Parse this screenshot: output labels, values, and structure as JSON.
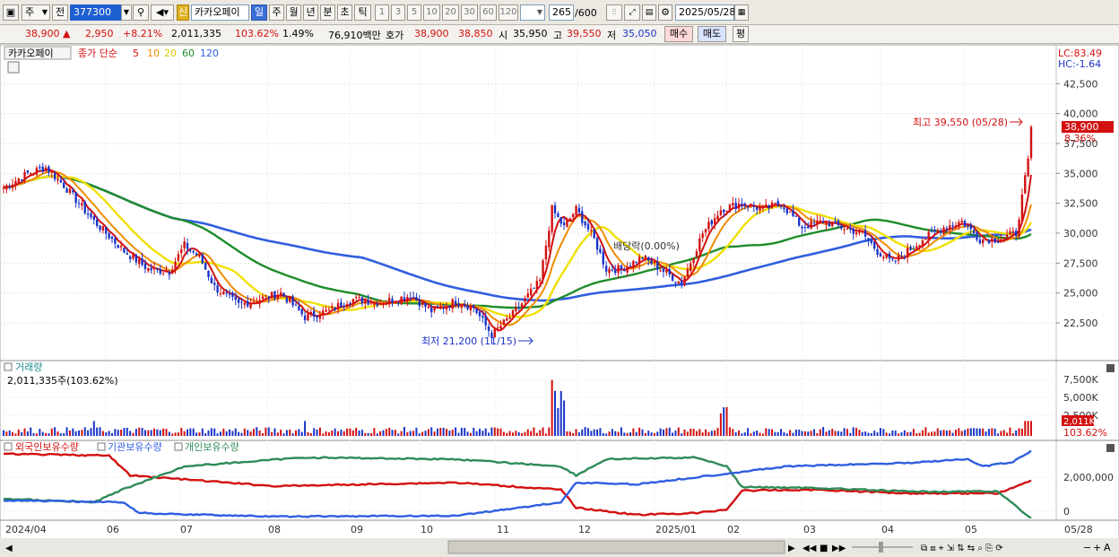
{
  "toolbar": {
    "market": "주",
    "prev": "전",
    "code": "377300",
    "stock_badge": "신",
    "stock_name": "카카오페이",
    "periods": [
      "일",
      "주",
      "월",
      "년",
      "분",
      "초",
      "틱"
    ],
    "active_period": "일",
    "pages": [
      "1",
      "3",
      "5",
      "10",
      "20",
      "30",
      "60",
      "120"
    ],
    "count": "265",
    "count_total": "/600",
    "date": "2025/05/28"
  },
  "quote": {
    "price": "38,900",
    "change": "2,950",
    "rate": "+8.21%",
    "volume": "2,011,335",
    "vol_ratio": "103.62%",
    "turnover": "1.49%",
    "amount": "76,910백만",
    "hoga_label": "호가",
    "hoga_ask": "38,900",
    "hoga_bid": "38,850",
    "open_label": "시",
    "open": "35,950",
    "high_label": "고",
    "high": "39,550",
    "low_label": "저",
    "low": "35,050",
    "buy": "매수",
    "sell": "매도",
    "avg": "평"
  },
  "main_panel": {
    "title": "카카오페이",
    "ma_label": "종가 단순",
    "ma_periods": [
      "5",
      "10",
      "20",
      "60",
      "120"
    ],
    "lc": "LC:83.49",
    "hc": "HC:-1.64",
    "annot_high": "최고 39,550 (05/28)",
    "annot_low": "최저 21,200 (11/15)",
    "annot_div": "배당락(0.00%)",
    "price_tag": "38,900",
    "price_pct": "8.36%"
  },
  "vol_panel": {
    "title": "거래량",
    "value": "2,011,335주(103.62%)",
    "tag": "2,011K",
    "tag_pct": "103.62%"
  },
  "hold_panel": {
    "legend": [
      "외국인보유수량",
      "기관보유수량",
      "개인보유수량"
    ]
  },
  "time_axis": [
    "2024/04",
    "06",
    "07",
    "08",
    "09",
    "10",
    "11",
    "12",
    "2025/01",
    "02",
    "03",
    "04",
    "05",
    "05/28"
  ],
  "colors": {
    "up": "#d31010",
    "down": "#1a34c8",
    "ma5": "#d31010",
    "ma10": "#f08c00",
    "ma20": "#f0e000",
    "ma60": "#1e8c2a",
    "ma120": "#2f5ee0",
    "foreign": "#d31010",
    "inst": "#2f5ee0",
    "indiv": "#2e8b57"
  },
  "chart_data": {
    "type": "candlestick",
    "price_ticks": [
      22500,
      25000,
      27500,
      30000,
      32500,
      35000,
      37500,
      40000,
      42500
    ],
    "volume_ticks": [
      "2,500K",
      "5,000K",
      "7,500K"
    ],
    "holding_ticks": [
      "0",
      "2,000,000"
    ],
    "price_anchors": [
      [
        0,
        33800
      ],
      [
        8,
        35000
      ],
      [
        14,
        35500
      ],
      [
        20,
        34000
      ],
      [
        30,
        31000
      ],
      [
        40,
        28500
      ],
      [
        48,
        27000
      ],
      [
        55,
        26800
      ],
      [
        60,
        29000
      ],
      [
        65,
        28000
      ],
      [
        70,
        25500
      ],
      [
        78,
        24000
      ],
      [
        85,
        24500
      ],
      [
        92,
        25000
      ],
      [
        100,
        23000
      ],
      [
        108,
        23500
      ],
      [
        115,
        24500
      ],
      [
        125,
        24200
      ],
      [
        135,
        24800
      ],
      [
        142,
        23500
      ],
      [
        150,
        24300
      ],
      [
        156,
        23800
      ],
      [
        162,
        21500
      ],
      [
        170,
        23500
      ],
      [
        178,
        26000
      ],
      [
        182,
        32000
      ],
      [
        186,
        30500
      ],
      [
        190,
        32000
      ],
      [
        196,
        29500
      ],
      [
        200,
        27000
      ],
      [
        205,
        27000
      ],
      [
        212,
        28000
      ],
      [
        218,
        27000
      ],
      [
        225,
        25800
      ],
      [
        232,
        30000
      ],
      [
        238,
        32000
      ],
      [
        245,
        32500
      ],
      [
        252,
        32000
      ],
      [
        258,
        32500
      ],
      [
        265,
        30500
      ],
      [
        272,
        31000
      ],
      [
        278,
        30500
      ],
      [
        285,
        30000
      ],
      [
        290,
        28500
      ],
      [
        295,
        27500
      ],
      [
        305,
        29500
      ],
      [
        312,
        30500
      ],
      [
        318,
        31000
      ],
      [
        324,
        29500
      ],
      [
        330,
        29500
      ],
      [
        336,
        30000
      ],
      [
        340,
        36000
      ],
      [
        341,
        38900
      ]
    ],
    "events": [
      {
        "label": "최고",
        "value": 39550,
        "date": "05/28"
      },
      {
        "label": "최저",
        "value": 21200,
        "date": "11/15"
      },
      {
        "label": "배당락",
        "value": "0.00%"
      }
    ]
  }
}
